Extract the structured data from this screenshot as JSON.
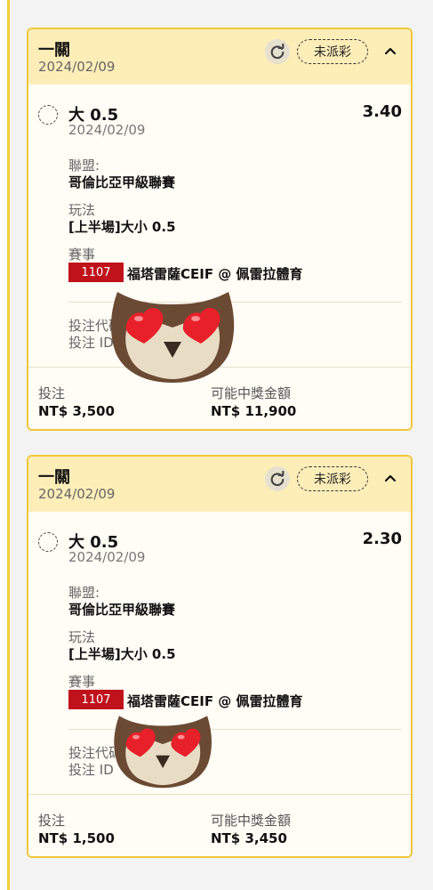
{
  "cards": [
    {
      "title": "一關",
      "date": "2024/02/09",
      "status": "未派彩",
      "selection": "大 0.5",
      "selection_date": "2024/02/09",
      "odds": "3.40",
      "league_label": "聯盟:",
      "league": "哥倫比亞甲級聯賽",
      "market_label": "玩法",
      "market": "[上半場]大小 0.5",
      "event_label": "賽事",
      "match_id": "1107",
      "match": "福塔雷薩CEIF @ 佩雷拉體育",
      "code_label": "投注代碼",
      "betid_label": "投注 ID",
      "stake_label": "投注",
      "stake": "NT$ 3,500",
      "payout_label": "可能中獎金額",
      "payout": "NT$ 11,900"
    },
    {
      "title": "一關",
      "date": "2024/02/09",
      "status": "未派彩",
      "selection": "大 0.5",
      "selection_date": "2024/02/09",
      "odds": "2.30",
      "league_label": "聯盟:",
      "league": "哥倫比亞甲級聯賽",
      "market_label": "玩法",
      "market": "[上半場]大小 0.5",
      "event_label": "賽事",
      "match_id": "1107",
      "match": "福塔雷薩CEIF @ 佩雷拉體育",
      "code_label": "投注代碼",
      "betid_label": "投注 ID",
      "stake_label": "投注",
      "stake": "NT$ 1,500",
      "payout_label": "可能中獎金額",
      "payout": "NT$ 3,450"
    }
  ],
  "icons": {
    "refresh": "refresh-icon",
    "collapse": "chevron-up-icon",
    "sticker": "owl-heart-eyes-sticker"
  },
  "colors": {
    "accent": "#f2c73a",
    "header_bg": "#fdeeb8",
    "match_badge": "#c0121b"
  }
}
